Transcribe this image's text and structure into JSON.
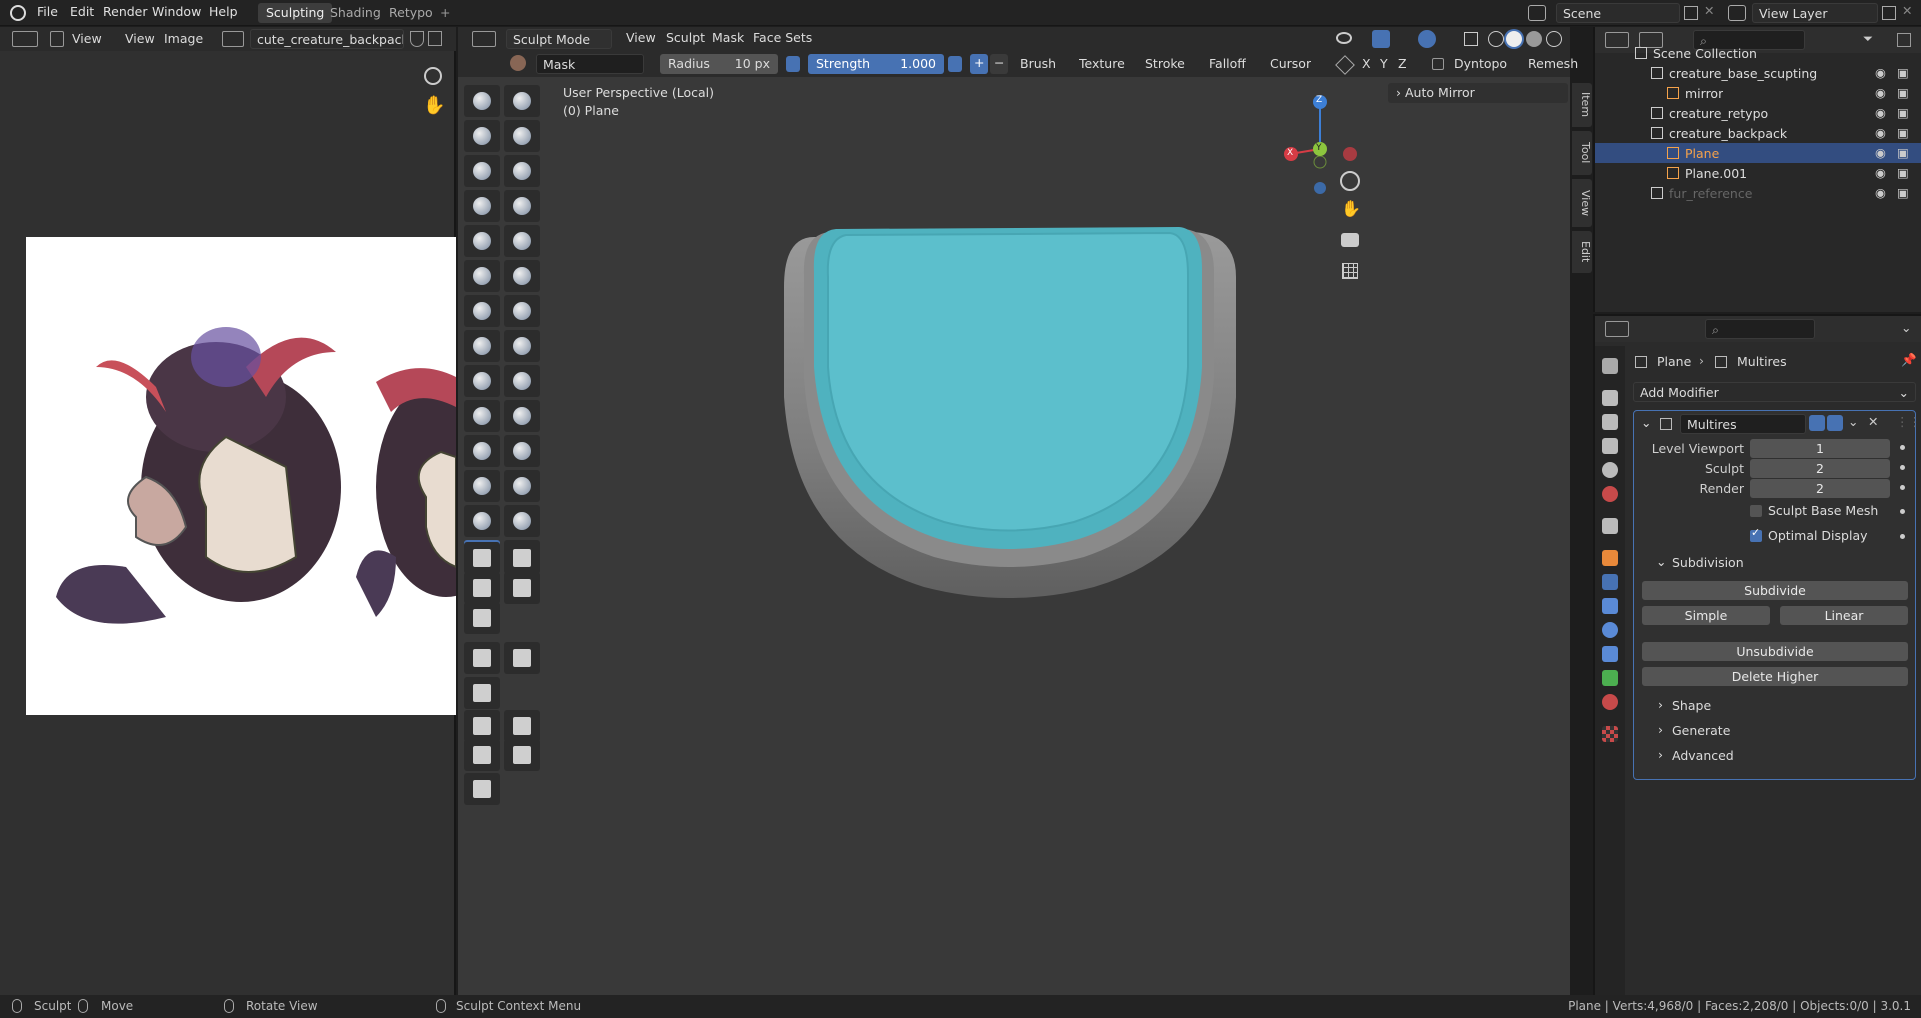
{
  "topbar": {
    "menus": [
      "File",
      "Edit",
      "Render",
      "Window",
      "Help"
    ],
    "workspaces": [
      "Sculpting",
      "Shading",
      "Retypo"
    ],
    "add_workspace": "+",
    "scene": "Scene",
    "view_layer": "View Layer"
  },
  "image_editor": {
    "view_label": "View",
    "menus": [
      "View",
      "Image"
    ],
    "filename": "cute_creature_backpack.jpg"
  },
  "viewport": {
    "mode": "Sculpt Mode",
    "menus": [
      "View",
      "Sculpt",
      "Mask",
      "Face Sets"
    ],
    "brush_name": "Mask",
    "radius_label": "Radius",
    "radius_value": "10 px",
    "strength_label": "Strength",
    "strength_value": "1.000",
    "plus": "+",
    "minus": "−",
    "dropdowns": [
      "Brush",
      "Texture",
      "Stroke",
      "Falloff",
      "Cursor"
    ],
    "axes": [
      "X",
      "Y",
      "Z"
    ],
    "dyntopo": "Dyntopo",
    "remesh": "Remesh",
    "overlay_title": "User Perspective (Local)",
    "overlay_object": "(0) Plane",
    "auto_mirror": "Auto Mirror",
    "side_tabs": [
      "Item",
      "Tool",
      "View",
      "Edit"
    ],
    "gizmo": {
      "x": "X",
      "y": "Y",
      "z": "Z"
    },
    "colors": {
      "mask": "#5cbfcc",
      "gizmo_x": "#d63c45",
      "gizmo_y": "#8cc53e",
      "gizmo_z": "#3d7fd6"
    }
  },
  "outliner": {
    "rows": [
      {
        "label": "Scene Collection",
        "indent": 0
      },
      {
        "label": "creature_base_scupting",
        "indent": 1
      },
      {
        "label": "mirror",
        "indent": 2
      },
      {
        "label": "creature_retypo",
        "indent": 1
      },
      {
        "label": "creature_backpack",
        "indent": 1
      },
      {
        "label": "Plane",
        "indent": 2
      },
      {
        "label": "Plane.001",
        "indent": 2
      },
      {
        "label": "fur_reference",
        "indent": 1
      }
    ]
  },
  "properties": {
    "breadcrumb_object": "Plane",
    "breadcrumb_modifier": "Multires",
    "add_modifier": "Add Modifier",
    "modifier_name": "Multires",
    "level_viewport_label": "Level Viewport",
    "level_viewport": "1",
    "sculpt_label": "Sculpt",
    "sculpt": "2",
    "render_label": "Render",
    "render": "2",
    "sculpt_base_mesh": "Sculpt Base Mesh",
    "optimal_display": "Optimal Display",
    "subdivision": "Subdivision",
    "subdivide": "Subdivide",
    "simple": "Simple",
    "linear": "Linear",
    "unsubdivide": "Unsubdivide",
    "delete_higher": "Delete Higher",
    "sections": [
      "Shape",
      "Generate",
      "Advanced"
    ]
  },
  "status": {
    "sculpt": "Sculpt",
    "move": "Move",
    "rotate_view": "Rotate View",
    "context_menu": "Sculpt Context Menu",
    "stats": "Plane | Verts:4,968/0 | Faces:2,208/0 | Objects:0/0 | 3.0.1"
  }
}
